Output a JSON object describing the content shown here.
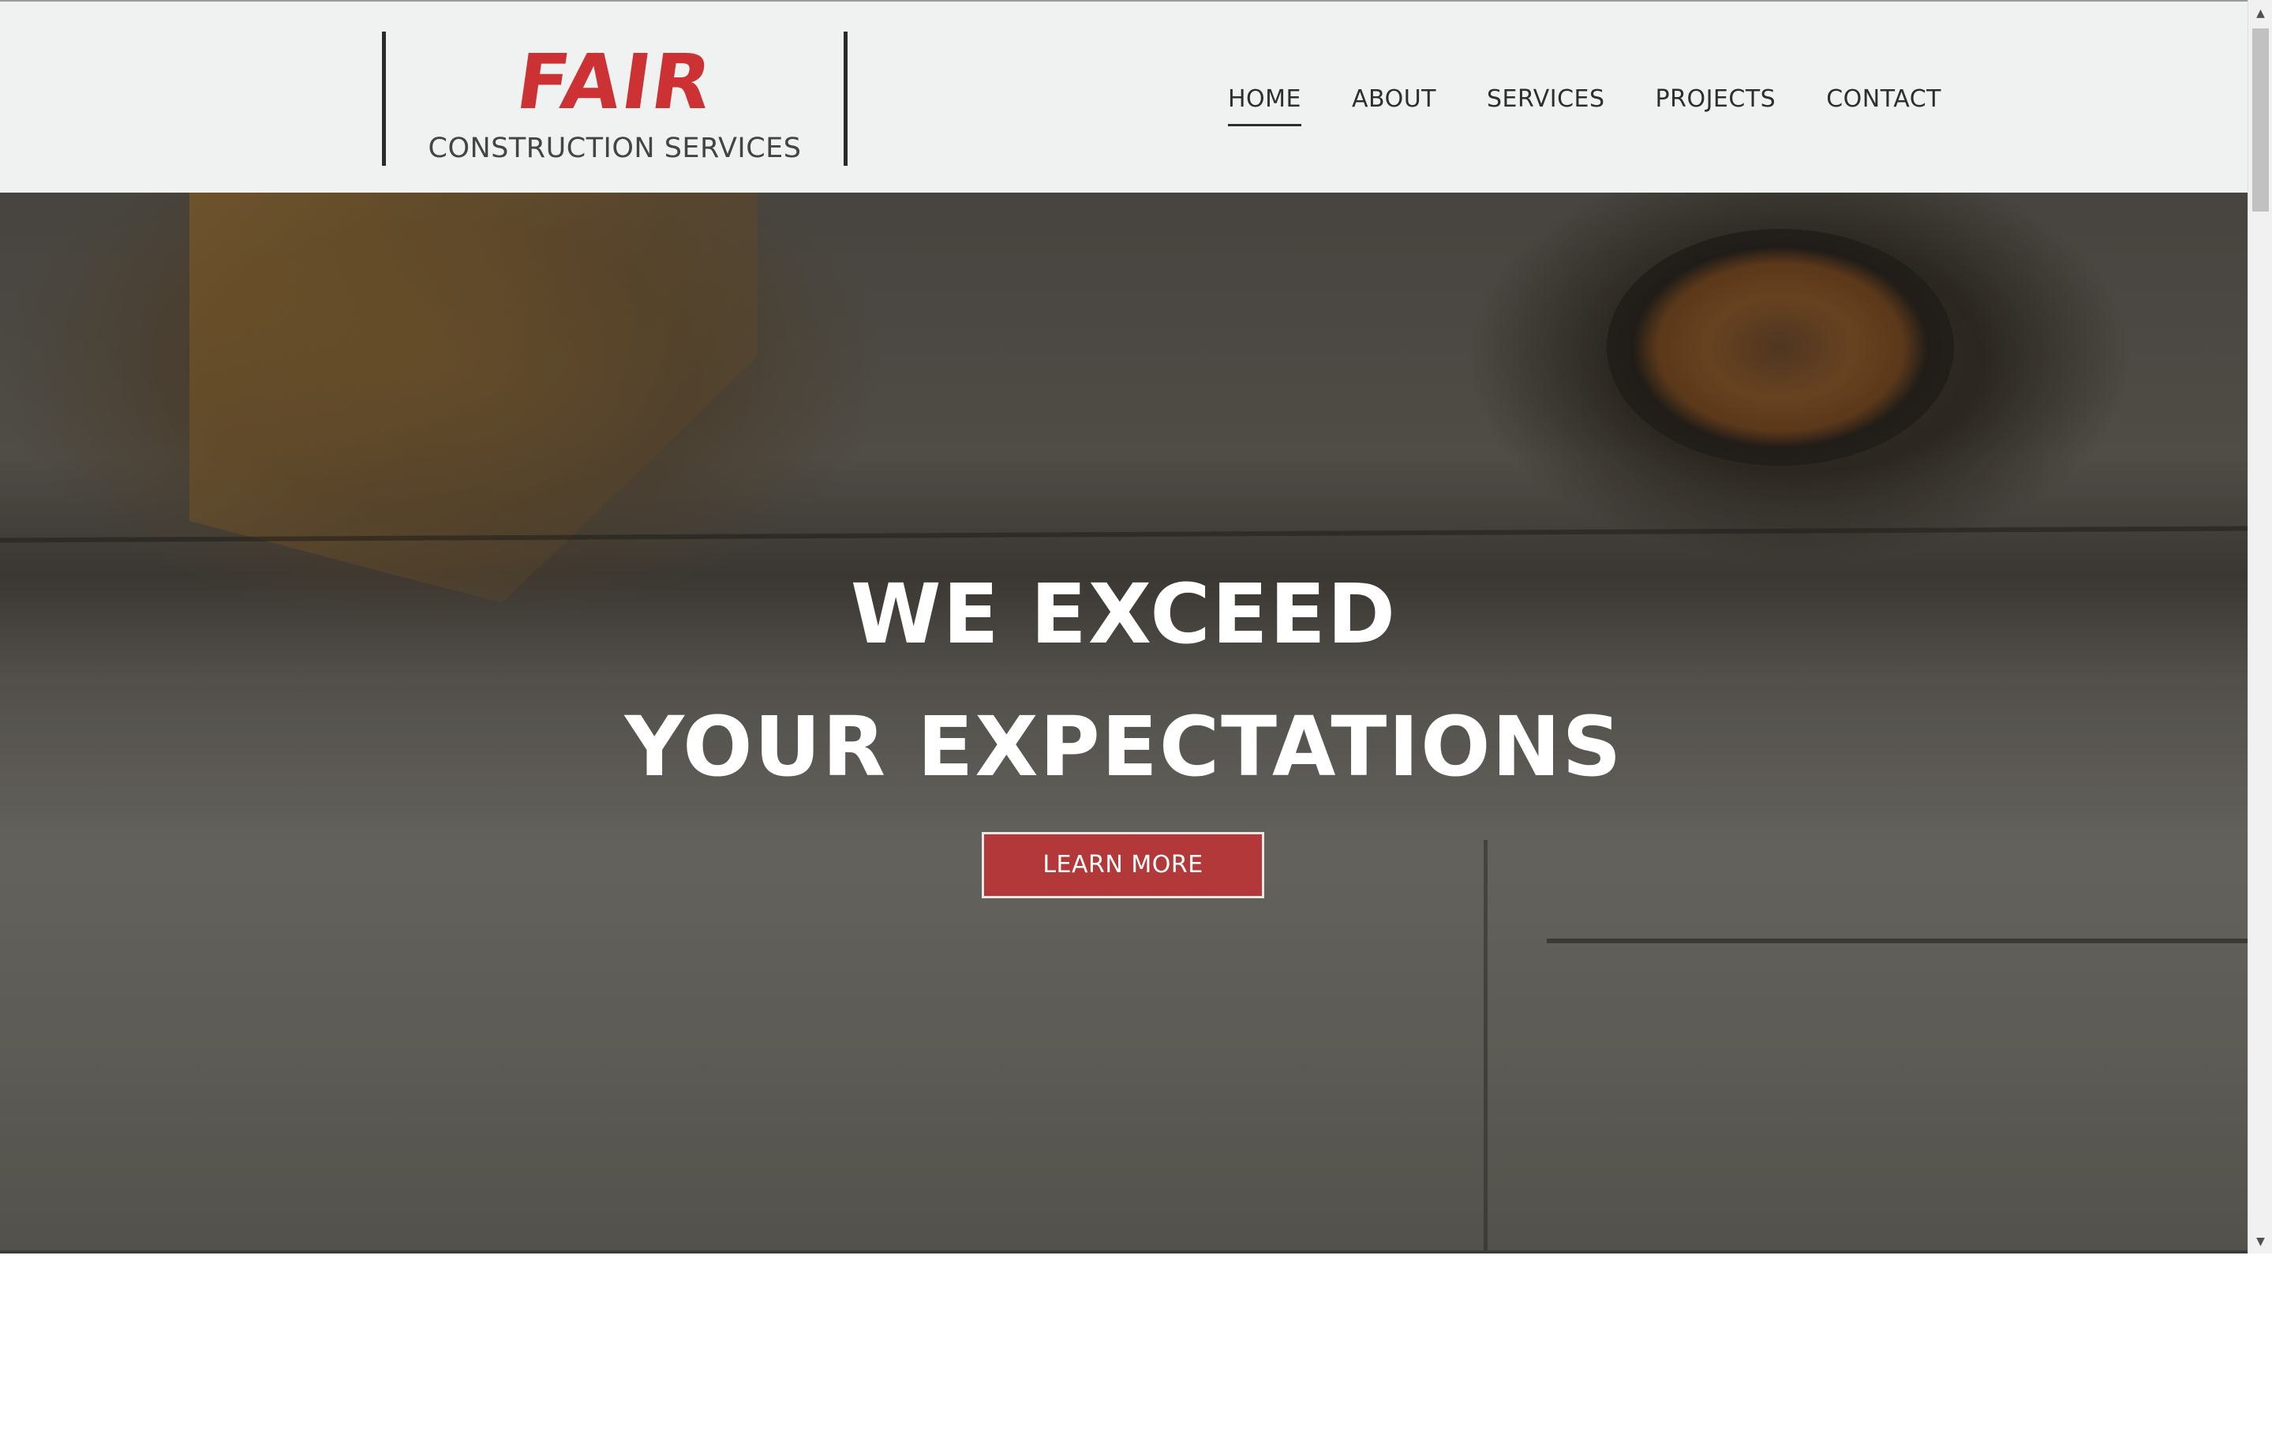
{
  "brand": {
    "name": "FAIR",
    "tagline": "CONSTRUCTION SERVICES",
    "accent_color": "#cc3233"
  },
  "nav": {
    "items": [
      {
        "label": "HOME",
        "active": true
      },
      {
        "label": "ABOUT",
        "active": false
      },
      {
        "label": "SERVICES",
        "active": false
      },
      {
        "label": "PROJECTS",
        "active": false
      },
      {
        "label": "CONTACT",
        "active": false
      }
    ]
  },
  "hero": {
    "headline_line1": "WE EXCEED",
    "headline_line2": "YOUR EXPECTATIONS",
    "cta_label": "LEARN MORE",
    "cta_color": "#b3383a"
  },
  "scrollbar": {
    "up_icon": "scroll-up-arrow-icon",
    "down_icon": "scroll-down-arrow-icon"
  }
}
